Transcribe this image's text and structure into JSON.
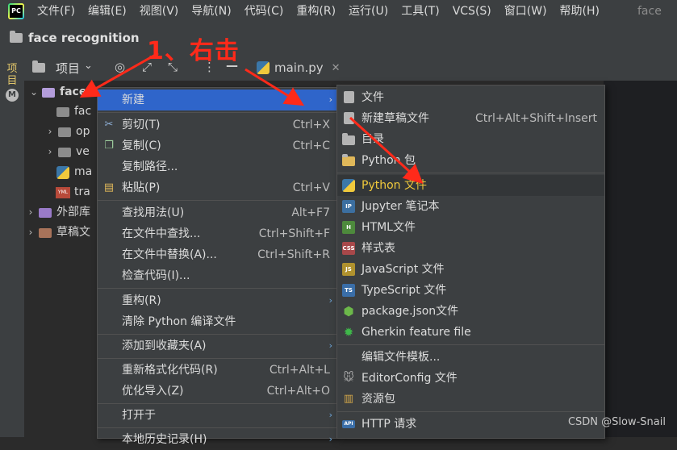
{
  "menubar": {
    "items": [
      "文件(F)",
      "编辑(E)",
      "视图(V)",
      "导航(N)",
      "代码(C)",
      "重构(R)",
      "运行(U)",
      "工具(T)",
      "VCS(S)",
      "窗口(W)",
      "帮助(H)"
    ],
    "window_title": "face recognition"
  },
  "navbar": {
    "breadcrumb": "face recognition"
  },
  "strip": {
    "project_label": "项目"
  },
  "project_panel": {
    "title": "项目"
  },
  "editor": {
    "tab_label": "main.py"
  },
  "tree": {
    "root": "face r",
    "items": [
      "fac",
      "op",
      "ve",
      "ma",
      "tra"
    ],
    "external": "外部库",
    "scratches": "草稿文"
  },
  "context_menu": {
    "new": "新建",
    "cut": "剪切(T)",
    "cut_shortcut": "Ctrl+X",
    "copy": "复制(C)",
    "copy_shortcut": "Ctrl+C",
    "copy_path": "复制路径...",
    "paste": "粘贴(P)",
    "paste_shortcut": "Ctrl+V",
    "find_usages": "查找用法(U)",
    "find_usages_shortcut": "Alt+F7",
    "find_in_files": "在文件中查找...",
    "find_in_files_shortcut": "Ctrl+Shift+F",
    "replace_in_files": "在文件中替换(A)...",
    "replace_in_files_shortcut": "Ctrl+Shift+R",
    "inspect_code": "检查代码(I)...",
    "refactor": "重构(R)",
    "clean_python": "清除 Python 编译文件",
    "add_favorites": "添加到收藏夹(A)",
    "reformat": "重新格式化代码(R)",
    "reformat_shortcut": "Ctrl+Alt+L",
    "optimize_imports": "优化导入(Z)",
    "optimize_imports_shortcut": "Ctrl+Alt+O",
    "open_in": "打开于",
    "local_history": "本地历史记录(H)"
  },
  "submenu": {
    "file": "文件",
    "scratch": "新建草稿文件",
    "scratch_shortcut": "Ctrl+Alt+Shift+Insert",
    "directory": "目录",
    "python_package": "Python 包",
    "python_file": "Python 文件",
    "jupyter": "Jupyter 笔记本",
    "html": "HTML文件",
    "stylesheet": "样式表",
    "javascript": "JavaScript 文件",
    "typescript": "TypeScript 文件",
    "package_json": "package.json文件",
    "gherkin": "Gherkin feature file",
    "edit_templates": "编辑文件模板...",
    "editorconfig": "EditorConfig 文件",
    "resource_bundle": "资源包",
    "http_request": "HTTP 请求"
  },
  "annotation": {
    "text": "1、右击"
  },
  "watermark": "CSDN @Slow-Snail",
  "colors": {
    "menu_bg": "#3c3f41",
    "highlight": "#2f65ca",
    "annotation": "#ff2a1a",
    "highlight_text": "#f0c93c"
  }
}
